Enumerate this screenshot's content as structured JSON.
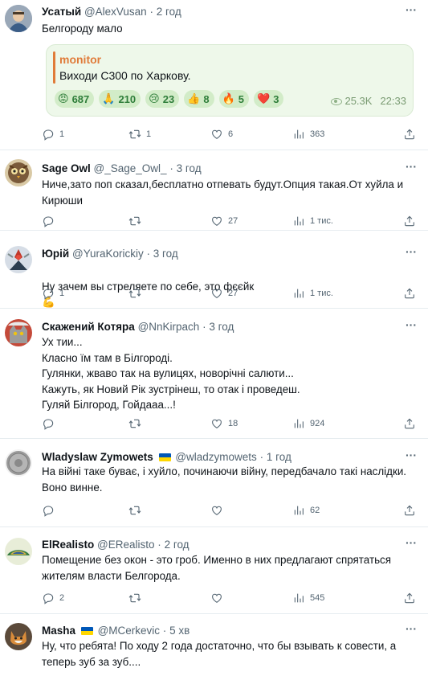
{
  "posts": [
    {
      "name": "Усатый",
      "handle": "@AlexVusan",
      "time": "2 год",
      "text": "Белгороду мало",
      "quote": {
        "source": "monitor",
        "message": "Виходи С300 по Харкову.",
        "reactions": [
          {
            "emoji": "😡",
            "count": "687"
          },
          {
            "emoji": "🙏",
            "count": "210"
          },
          {
            "emoji": "😢",
            "count": "23"
          },
          {
            "emoji": "👍",
            "count": "8"
          },
          {
            "emoji": "🔥",
            "count": "5"
          },
          {
            "emoji": "❤️",
            "count": "3"
          }
        ],
        "views": "25.3K",
        "time": "22:33"
      },
      "replies": "1",
      "retweets": "1",
      "likes": "6",
      "views": "363"
    },
    {
      "name": "Sage Owl",
      "handle": "@_Sage_Owl_",
      "time": "3 год",
      "text": "Ниче,зато поп сказал,бесплатно отпевать будут.Опция такая.От хуйла и Кирюши",
      "replies": "",
      "retweets": "",
      "likes": "27",
      "views": "1 тис."
    },
    {
      "name": "Юрій",
      "handle": "@YuraKorickiy",
      "time": "3 год",
      "text": "Ну зачем вы стреляете по себе, это фєєйк",
      "emoji": "💪",
      "replies": "1",
      "retweets": "",
      "likes": "27",
      "views": "1 тис."
    },
    {
      "name": "Скажений Котяра",
      "handle": "@NnKirpach",
      "time": "3 год",
      "text": "Ух тии...\nКласно їм там в Білгороді.\n Гулянки, жваво так на вулицях, новорічні салюти...\nКажуть, як Новий Рік зустрінеш, то отак і проведеш.\nГуляй Білгород, Гойдааа...!",
      "replies": "",
      "retweets": "",
      "likes": "18",
      "views": "924"
    },
    {
      "name": "Wladyslaw Zymowets",
      "handle": "@wladzymowets",
      "time": "1 год",
      "flag": true,
      "text": "На війні таке буває, і хуйло, починаючи війну, передбачало такі наслідки. Воно винне.",
      "replies": "",
      "retweets": "",
      "likes": "",
      "views": "62"
    },
    {
      "name": "ElRealisto",
      "handle": "@ERealisto",
      "time": "2 год",
      "text": "Помещение без окон - это гроб. Именно в них предлагают спрятаться жителям власти Белгорода.",
      "replies": "2",
      "retweets": "",
      "likes": "",
      "views": "545"
    },
    {
      "name": "Masha",
      "handle": "@MCerkevic",
      "time": "5 хв",
      "flag": true,
      "text": "Ну, что ребята! По ходу 2 года достаточно, что бы взывать к совести, а теперь зуб за зуб....",
      "replies": "",
      "retweets": "",
      "likes": "",
      "views": ""
    }
  ],
  "icons": {
    "more": "more-icon",
    "reply": "reply-icon",
    "retweet": "retweet-icon",
    "like": "heart-icon",
    "views": "views-icon",
    "share": "share-icon"
  },
  "colors": {
    "text": "#0f1419",
    "meta": "#536471",
    "divider": "#e6ecf0",
    "telegram_source": "#e07b39",
    "telegram_bg": "#eef8ea",
    "reaction_bg": "#d2ecc8"
  }
}
